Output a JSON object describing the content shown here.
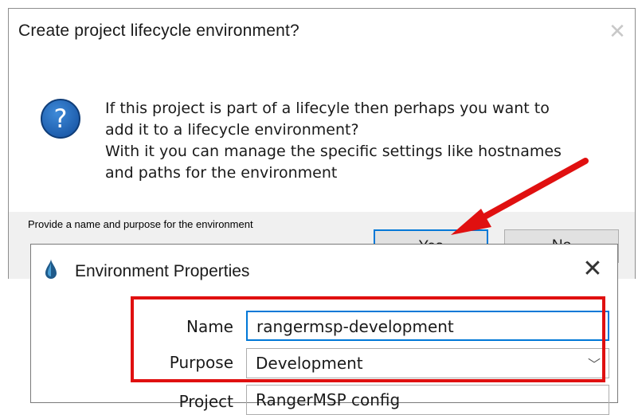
{
  "dialog1": {
    "title": "Create project lifecycle environment?",
    "close_glyph": "✕",
    "icon": "question-icon",
    "icon_glyph": "?",
    "message_lines": [
      "If this project is part of a lifecyle then perhaps you want to",
      "add it to a lifecycle environment?",
      "With it you can manage the specific settings like hostnames",
      "and paths for the environment"
    ],
    "footer_caption": "Provide a name and purpose for the environment",
    "yes_label": "Yes",
    "no_label": "No"
  },
  "dialog2": {
    "title": "Environment Properties",
    "close_glyph": "✕",
    "icon": "app-drop-icon",
    "name_label": "Name",
    "name_value": "rangermsp-development",
    "purpose_label": "Purpose",
    "purpose_value": "Development",
    "purpose_chevron": "﹀",
    "partial_row_label": "Project",
    "partial_row_value": "RangerMSP config"
  },
  "annotation": {
    "color": "#e01010"
  }
}
